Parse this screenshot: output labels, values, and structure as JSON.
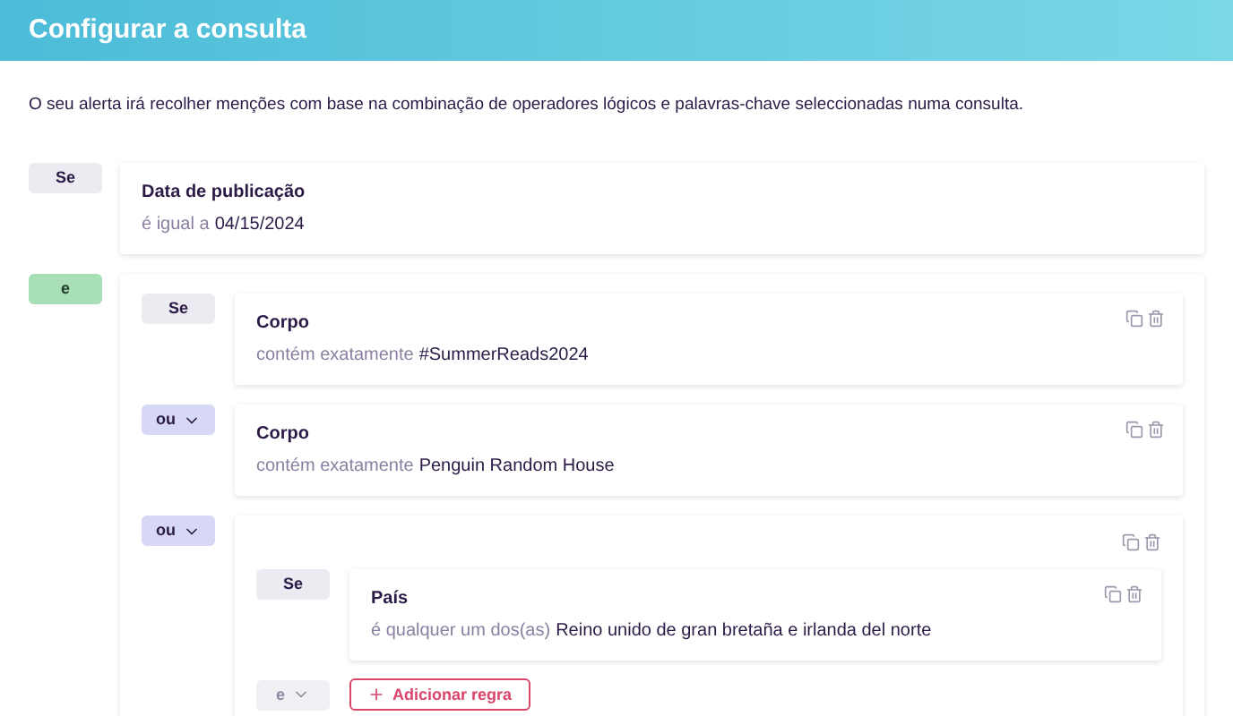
{
  "header": {
    "title": "Configurar a consulta"
  },
  "description": "O seu alerta irá recolher menções com base na combinação de operadores lógicos e palavras-chave seleccionadas numa consulta.",
  "query": [
    {
      "operator": {
        "label": "Se",
        "kind": "plain"
      },
      "kind": "rule",
      "field": "Data de publicação",
      "condition": "é igual a",
      "value": "04/15/2024",
      "actions": false
    },
    {
      "operator": {
        "label": "e",
        "kind": "and"
      },
      "kind": "group",
      "actions": false,
      "items": [
        {
          "operator": {
            "label": "Se",
            "kind": "plain"
          },
          "kind": "rule",
          "field": "Corpo",
          "condition": "contém exatamente",
          "value": "#SummerReads2024",
          "actions": true
        },
        {
          "operator": {
            "label": "ou",
            "kind": "dropdown",
            "disabled": false
          },
          "kind": "rule",
          "field": "Corpo",
          "condition": "contém exatamente",
          "value": "Penguin Random House",
          "actions": true
        },
        {
          "operator": {
            "label": "ou",
            "kind": "dropdown",
            "disabled": false
          },
          "kind": "group",
          "actions": true,
          "items": [
            {
              "operator": {
                "label": "Se",
                "kind": "plain"
              },
              "kind": "rule",
              "field": "País",
              "condition": "é qualquer um dos(as)",
              "value": "Reino unido de gran bretaña e irlanda del norte",
              "actions": true
            }
          ],
          "footer": {
            "operator": {
              "label": "e",
              "kind": "dropdown",
              "disabled": true
            },
            "add_button": "Adicionar regra"
          }
        }
      ]
    }
  ]
}
